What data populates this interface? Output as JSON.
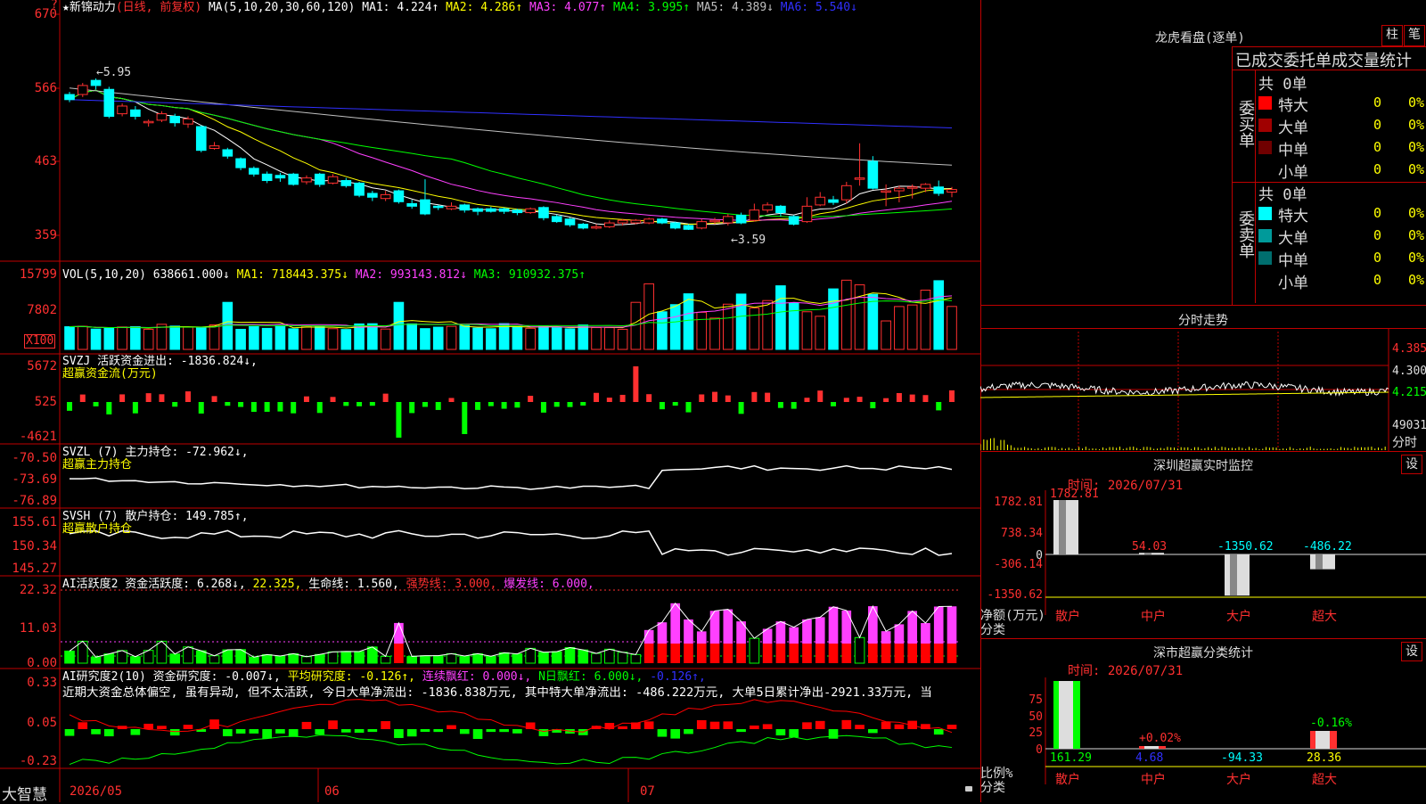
{
  "left": {
    "main_title": {
      "star": "★",
      "name": "新锦动力",
      "period": "(日线, 前复权)",
      "ma_label": "MA(5,10,20,30,60,120)",
      "items": [
        {
          "text": "MA1: 4.224↑",
          "color": "#ffffff"
        },
        {
          "text": "MA2: 4.286↑",
          "color": "#ffff00"
        },
        {
          "text": "MA3: 4.077↑",
          "color": "#ff40ff"
        },
        {
          "text": "MA4: 3.995↑",
          "color": "#00ff00"
        },
        {
          "text": "MA5: 4.389↓",
          "color": "#c0c0c0"
        },
        {
          "text": "MA6: 5.540↓",
          "color": "#3030ff"
        }
      ],
      "arrow_mark": "?"
    },
    "price_axis": [
      "670",
      "566",
      "463",
      "359"
    ],
    "high_mark": "←5.95",
    "low_mark": "←3.59",
    "vol": {
      "label": "VOL(5,10,20)",
      "items": [
        {
          "text": "638661.000↓",
          "color": "#ffffff"
        },
        {
          "text": "MA1: 718443.375↓",
          "color": "#ffff00"
        },
        {
          "text": "MA2: 993143.812↓",
          "color": "#ff40ff"
        },
        {
          "text": "MA3: 910932.375↑",
          "color": "#00ff00"
        }
      ],
      "axis": [
        "15799",
        "7802"
      ],
      "unit": "X100"
    },
    "svzj": {
      "label": "SVZJ  活跃资金进出: -1836.824↓,",
      "sub": "超赢资金流(万元)",
      "axis": [
        "5672",
        "525",
        "-4621"
      ]
    },
    "svzl": {
      "label": "SVZL (7) 主力持仓: -72.962↓,",
      "sub": "超赢主力持仓",
      "axis": [
        "-70.50",
        "-73.69",
        "-76.89"
      ]
    },
    "svsh": {
      "label": "SVSH (7) 散户持仓: 149.785↑,",
      "sub": "超赢散户持仓",
      "axis": [
        "155.61",
        "150.34",
        "145.27"
      ]
    },
    "ai_active": {
      "items": [
        {
          "text": "AI活跃度2 资金活跃度: 6.268↓,",
          "color": "#ffffff"
        },
        {
          "text": "22.325,",
          "color": "#ffff00"
        },
        {
          "text": "生命线: 1.560,",
          "color": "#ffffff"
        },
        {
          "text": "强势线: 3.000,",
          "color": "#ff3030"
        },
        {
          "text": "爆发线: 6.000,",
          "color": "#ff40ff"
        }
      ],
      "axis": [
        "22.32",
        "11.03",
        "0.00"
      ]
    },
    "ai_research": {
      "items": [
        {
          "text": "AI研究度2(10) 资金研究度: -0.007↓,",
          "color": "#ffffff"
        },
        {
          "text": "平均研究度: -0.126↑,",
          "color": "#ffff00"
        },
        {
          "text": "连续飘红: 0.000↓,",
          "color": "#ff40ff"
        },
        {
          "text": "N日飘红: 6.000↓,",
          "color": "#00ff00"
        },
        {
          "text": "-0.126↑,",
          "color": "#3030ff"
        }
      ],
      "commentary": "近期大资金总体偏空, 虽有异动, 但不太活跃, 今日大单净流出: -1836.838万元, 其中特大单净流出: -486.222万元, 大单5日累计净出-2921.33万元, 当",
      "axis": [
        "0.33",
        "0.05",
        "-0.23"
      ]
    },
    "bottom": {
      "brand": "大智慧",
      "dates": [
        "2026/05",
        "06",
        "07"
      ]
    }
  },
  "chart_data": {
    "type": "candlestick",
    "title": "新锦动力(日线, 前复权)",
    "candles": [
      {
        "o": 5.7,
        "c": 5.62,
        "h": 5.74,
        "l": 5.58
      },
      {
        "o": 5.7,
        "c": 5.84,
        "h": 5.88,
        "l": 5.66
      },
      {
        "o": 5.92,
        "c": 5.84,
        "h": 5.95,
        "l": 5.78
      },
      {
        "o": 5.78,
        "c": 5.36,
        "h": 5.82,
        "l": 5.33
      },
      {
        "o": 5.4,
        "c": 5.52,
        "h": 5.56,
        "l": 5.36
      },
      {
        "o": 5.46,
        "c": 5.36,
        "h": 5.52,
        "l": 5.31
      },
      {
        "o": 5.28,
        "c": 5.28,
        "h": 5.31,
        "l": 5.2
      },
      {
        "o": 5.3,
        "c": 5.4,
        "h": 5.44,
        "l": 5.27
      },
      {
        "o": 5.36,
        "c": 5.26,
        "h": 5.4,
        "l": 5.2
      },
      {
        "o": 5.24,
        "c": 5.32,
        "h": 5.36,
        "l": 5.18
      },
      {
        "o": 5.2,
        "c": 4.83,
        "h": 5.22,
        "l": 4.8
      },
      {
        "o": 4.86,
        "c": 4.9,
        "h": 4.96,
        "l": 4.84
      },
      {
        "o": 4.84,
        "c": 4.74,
        "h": 4.87,
        "l": 4.7
      },
      {
        "o": 4.7,
        "c": 4.56,
        "h": 4.72,
        "l": 4.52
      },
      {
        "o": 4.55,
        "c": 4.46,
        "h": 4.58,
        "l": 4.42
      },
      {
        "o": 4.46,
        "c": 4.36,
        "h": 4.5,
        "l": 4.32
      },
      {
        "o": 4.44,
        "c": 4.4,
        "h": 4.48,
        "l": 4.34
      },
      {
        "o": 4.46,
        "c": 4.3,
        "h": 4.48,
        "l": 4.28
      },
      {
        "o": 4.34,
        "c": 4.4,
        "h": 4.44,
        "l": 4.3
      },
      {
        "o": 4.46,
        "c": 4.3,
        "h": 4.48,
        "l": 4.26
      },
      {
        "o": 4.32,
        "c": 4.42,
        "h": 4.46,
        "l": 4.3
      },
      {
        "o": 4.36,
        "c": 4.28,
        "h": 4.4,
        "l": 4.25
      },
      {
        "o": 4.32,
        "c": 4.13,
        "h": 4.34,
        "l": 4.1
      },
      {
        "o": 4.16,
        "c": 4.1,
        "h": 4.2,
        "l": 4.04
      },
      {
        "o": 4.08,
        "c": 4.14,
        "h": 4.2,
        "l": 4.04
      },
      {
        "o": 4.2,
        "c": 4.03,
        "h": 4.22,
        "l": 4.0
      },
      {
        "o": 4.0,
        "c": 3.96,
        "h": 4.06,
        "l": 3.92
      },
      {
        "o": 4.06,
        "c": 3.84,
        "h": 4.38,
        "l": 3.82
      },
      {
        "o": 3.96,
        "c": 3.94,
        "h": 3.98,
        "l": 3.9
      },
      {
        "o": 3.92,
        "c": 3.96,
        "h": 4.02,
        "l": 3.9
      },
      {
        "o": 3.98,
        "c": 3.9,
        "h": 4.0,
        "l": 3.86
      },
      {
        "o": 3.92,
        "c": 3.88,
        "h": 3.94,
        "l": 3.82
      },
      {
        "o": 3.92,
        "c": 3.88,
        "h": 3.95,
        "l": 3.86
      },
      {
        "o": 3.92,
        "c": 3.88,
        "h": 3.94,
        "l": 3.84
      },
      {
        "o": 3.9,
        "c": 3.86,
        "h": 3.92,
        "l": 3.82
      },
      {
        "o": 3.86,
        "c": 3.92,
        "h": 3.94,
        "l": 3.84
      },
      {
        "o": 3.94,
        "c": 3.78,
        "h": 3.96,
        "l": 3.74
      },
      {
        "o": 3.8,
        "c": 3.72,
        "h": 3.83,
        "l": 3.7
      },
      {
        "o": 3.76,
        "c": 3.67,
        "h": 3.78,
        "l": 3.64
      },
      {
        "o": 3.68,
        "c": 3.62,
        "h": 3.7,
        "l": 3.6
      },
      {
        "o": 3.64,
        "c": 3.64,
        "h": 3.68,
        "l": 3.6
      },
      {
        "o": 3.64,
        "c": 3.7,
        "h": 3.74,
        "l": 3.62
      },
      {
        "o": 3.7,
        "c": 3.74,
        "h": 3.76,
        "l": 3.66
      },
      {
        "o": 3.7,
        "c": 3.74,
        "h": 3.76,
        "l": 3.68
      },
      {
        "o": 3.7,
        "c": 3.76,
        "h": 3.78,
        "l": 3.68
      },
      {
        "o": 3.76,
        "c": 3.7,
        "h": 3.78,
        "l": 3.68
      },
      {
        "o": 3.7,
        "c": 3.62,
        "h": 3.72,
        "l": 3.6
      },
      {
        "o": 3.66,
        "c": 3.6,
        "h": 3.68,
        "l": 3.59
      },
      {
        "o": 3.62,
        "c": 3.72,
        "h": 3.76,
        "l": 3.6
      },
      {
        "o": 3.72,
        "c": 3.74,
        "h": 3.78,
        "l": 3.68
      },
      {
        "o": 3.7,
        "c": 3.8,
        "h": 3.84,
        "l": 3.66
      },
      {
        "o": 3.82,
        "c": 3.7,
        "h": 3.86,
        "l": 3.68
      },
      {
        "o": 3.74,
        "c": 3.9,
        "h": 4.0,
        "l": 3.72
      },
      {
        "o": 3.9,
        "c": 3.98,
        "h": 4.02,
        "l": 3.86
      },
      {
        "o": 3.96,
        "c": 3.86,
        "h": 3.98,
        "l": 3.8
      },
      {
        "o": 3.8,
        "c": 3.68,
        "h": 3.82,
        "l": 3.66
      },
      {
        "o": 3.72,
        "c": 3.96,
        "h": 4.1,
        "l": 3.7
      },
      {
        "o": 3.98,
        "c": 4.1,
        "h": 4.18,
        "l": 3.96
      },
      {
        "o": 4.06,
        "c": 4.02,
        "h": 4.12,
        "l": 3.98
      },
      {
        "o": 4.06,
        "c": 4.28,
        "h": 4.34,
        "l": 4.0
      },
      {
        "o": 4.4,
        "c": 4.4,
        "h": 4.94,
        "l": 4.28
      },
      {
        "o": 4.66,
        "c": 4.24,
        "h": 4.74,
        "l": 4.22
      },
      {
        "o": 4.2,
        "c": 4.2,
        "h": 4.3,
        "l": 3.96
      },
      {
        "o": 4.2,
        "c": 4.24,
        "h": 4.28,
        "l": 4.02
      },
      {
        "o": 4.24,
        "c": 4.26,
        "h": 4.3,
        "l": 4.08
      },
      {
        "o": 4.24,
        "c": 4.3,
        "h": 4.32,
        "l": 4.18
      },
      {
        "o": 4.26,
        "c": 4.16,
        "h": 4.36,
        "l": 4.12
      },
      {
        "o": 4.18,
        "c": 4.22,
        "h": 4.26,
        "l": 4.1
      }
    ],
    "ylim": [
      3.3,
      6.3
    ]
  },
  "right": {
    "longhu": {
      "title": "龙虎看盘(逐单)",
      "btn1": "柱",
      "btn2": "笔",
      "subtitle": "已成交委托单成交量统计"
    },
    "buy": {
      "side_label": [
        "委",
        "买",
        "单"
      ],
      "total": "共 0单",
      "rows": [
        {
          "name": "特大",
          "val": "0",
          "pct": "0%",
          "color": "#ff0000"
        },
        {
          "name": "大单",
          "val": "0",
          "pct": "0%",
          "color": "#a00000"
        },
        {
          "name": "中单",
          "val": "0",
          "pct": "0%",
          "color": "#700000"
        },
        {
          "name": "小单",
          "val": "0",
          "pct": "0%",
          "color": "#000000"
        }
      ]
    },
    "sell": {
      "side_label": [
        "委",
        "卖",
        "单"
      ],
      "total": "共 0单",
      "rows": [
        {
          "name": "特大",
          "val": "0",
          "pct": "0%",
          "color": "#00ffff"
        },
        {
          "name": "大单",
          "val": "0",
          "pct": "0%",
          "color": "#009a9a"
        },
        {
          "name": "中单",
          "val": "0",
          "pct": "0%",
          "color": "#006e6e"
        },
        {
          "name": "小单",
          "val": "0",
          "pct": "0%",
          "color": "#000000"
        }
      ]
    },
    "intraday": {
      "title": "分时走势",
      "prices": [
        "4.385",
        "4.300",
        "4.215"
      ],
      "vol": "49031",
      "unit": "分时"
    },
    "monitor": {
      "title": "深圳超赢实时监控",
      "btn": "设",
      "time": "时间: 2026/07/31",
      "axis": [
        "1782.81",
        "738.34",
        "0",
        "-306.14",
        "-1350.62"
      ],
      "ylabel": "净额(万元)",
      "xlabel": "分类",
      "bars": [
        {
          "cat": "散户",
          "value": 1782.81,
          "label": "1782.81"
        },
        {
          "cat": "中户",
          "value": 54.03,
          "label": "54.03"
        },
        {
          "cat": "大户",
          "value": -1350.62,
          "label": "-1350.62"
        },
        {
          "cat": "超大",
          "value": -486.22,
          "label": "-486.22"
        }
      ]
    },
    "classify": {
      "title": "深市超赢分类统计",
      "btn": "设",
      "time": "时间: 2026/07/31",
      "axis": [
        "75",
        "50",
        "25",
        "0"
      ],
      "ylabel": "比例%",
      "xlabel": "分类",
      "bars": [
        {
          "cat": "散户",
          "value": 161.29,
          "label": "161.29",
          "pct": "",
          "color": "#00ff00"
        },
        {
          "cat": "中户",
          "value": 4.68,
          "label": "4.68",
          "pct": "+0.02%",
          "color": "#3030ff"
        },
        {
          "cat": "大户",
          "value": -94.33,
          "label": "-94.33",
          "pct": "",
          "color": "#00ffff"
        },
        {
          "cat": "超大",
          "value": 28.36,
          "label": "28.36",
          "pct": "-0.16%",
          "color": "#ffff00"
        }
      ]
    }
  }
}
